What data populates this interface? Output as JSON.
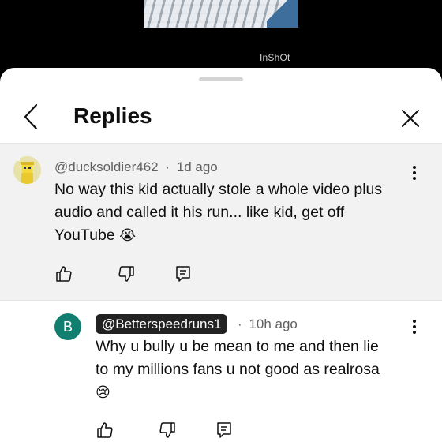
{
  "video": {
    "watermark": "InShOt"
  },
  "header": {
    "title": "Replies"
  },
  "parent_comment": {
    "author": "@ducksoldier462",
    "separator": "·",
    "time": "1d ago",
    "text_lines": [
      "No way this kid actually stole a whole video plus",
      "audio and called it his run... like kid, get off",
      "YouTube"
    ],
    "emoji": "😭"
  },
  "reply": {
    "avatar_letter": "B",
    "author": "@Betterspeedruns1",
    "separator": "·",
    "time": "10h ago",
    "text_lines": [
      "Why u bully u be mean to me and then lie",
      "to my millions fans u not good as realrosa"
    ],
    "emoji": "😢"
  },
  "icons": {
    "back": "chevron-left-icon",
    "close": "close-icon",
    "more": "more-vertical-icon",
    "like": "thumbs-up-icon",
    "dislike": "thumbs-down-icon",
    "reply": "reply-comment-icon"
  },
  "colors": {
    "reply_avatar_bg": "#107f6f",
    "parent_bg": "#f2f2f2",
    "handle_pill_bg": "#222222"
  }
}
